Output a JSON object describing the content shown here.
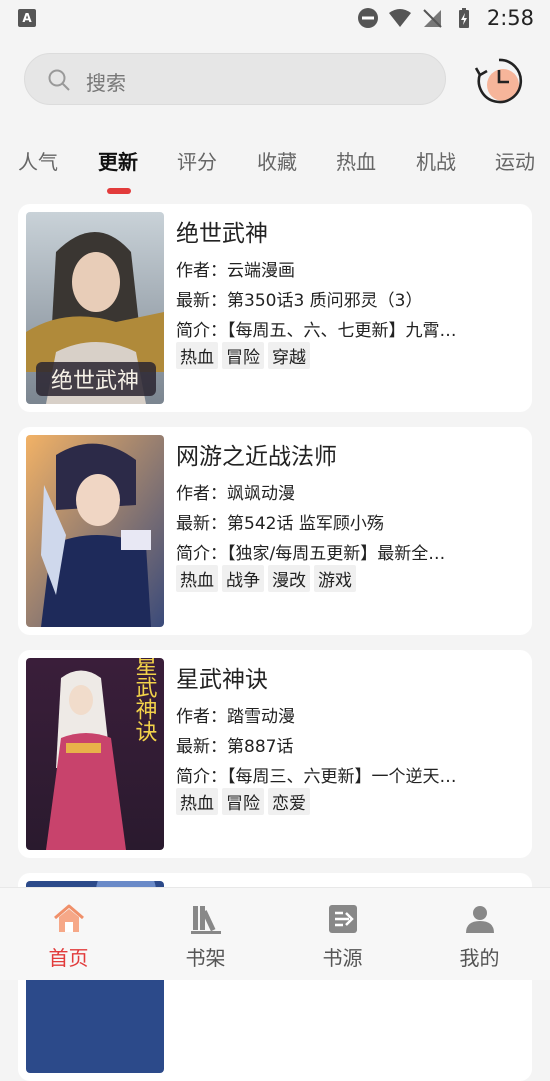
{
  "status_bar": {
    "time": "2:58"
  },
  "search": {
    "placeholder": "搜索"
  },
  "tabs": [
    {
      "label": "人气"
    },
    {
      "label": "更新"
    },
    {
      "label": "评分"
    },
    {
      "label": "收藏"
    },
    {
      "label": "热血"
    },
    {
      "label": "机战"
    },
    {
      "label": "运动"
    }
  ],
  "active_tab": "更新",
  "comics": [
    {
      "title": "绝世武神",
      "author": "作者：云端漫画",
      "latest": "最新：第350话3 质问邪灵（3）",
      "intro": "简介：【每周五、六、七更新】九霄…",
      "tags": [
        "热血",
        "冒险",
        "穿越"
      ],
      "cover_text": "绝世武神"
    },
    {
      "title": "网游之近战法师",
      "author": "作者：飒飒动漫",
      "latest": "最新：第542话 监军顾小殇",
      "intro": "简介：【独家/每周五更新】最新全…",
      "tags": [
        "热血",
        "战争",
        "漫改",
        "游戏"
      ]
    },
    {
      "title": "星武神诀",
      "author": "作者：踏雪动漫",
      "latest": "最新：第887话",
      "intro": "简介：【每周三、六更新】一个逆天…",
      "tags": [
        "热血",
        "冒险",
        "恋爱"
      ],
      "cover_text": "星武神诀"
    }
  ],
  "bottom_nav": [
    {
      "label": "首页",
      "icon": "home-icon"
    },
    {
      "label": "书架",
      "icon": "bookshelf-icon"
    },
    {
      "label": "书源",
      "icon": "source-icon"
    },
    {
      "label": "我的",
      "icon": "profile-icon"
    }
  ],
  "colors": {
    "accent": "#e23b3b",
    "background": "#f4f4f4",
    "card": "#ffffff"
  }
}
